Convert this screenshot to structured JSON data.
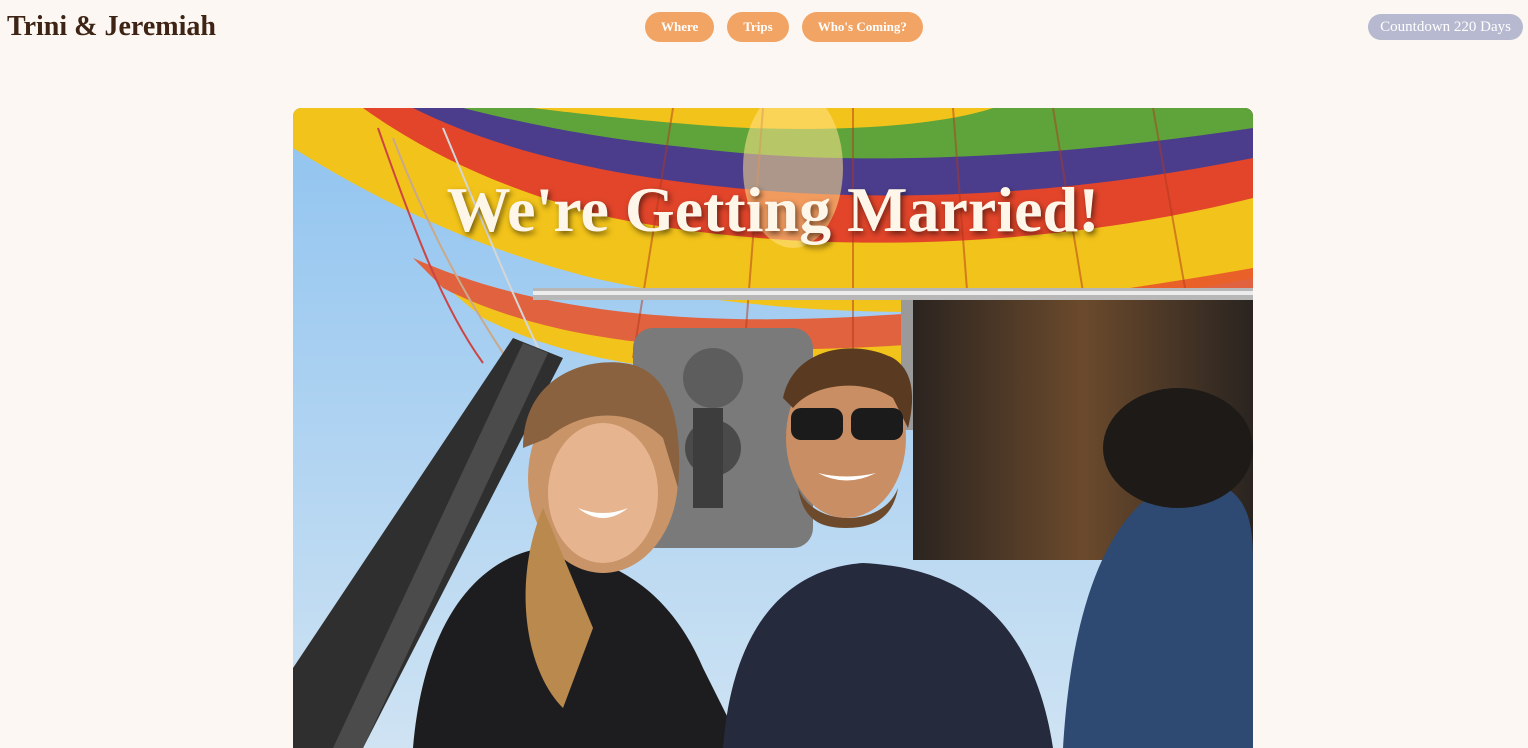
{
  "header": {
    "site_title": "Trini & Jeremiah",
    "nav": [
      {
        "label": "Where"
      },
      {
        "label": "Trips"
      },
      {
        "label": "Who's Coming?"
      }
    ],
    "countdown": "Countdown 220 Days"
  },
  "hero": {
    "heading": "We're Getting Married!",
    "photo_description_icon": "hot-air-balloon-couple-photo"
  },
  "colors": {
    "background": "#fdf7f3",
    "title_text": "#3d2414",
    "nav_pill": "#f1a464",
    "countdown_badge": "#b6b9cf",
    "heading_text": "#fff6ea"
  }
}
